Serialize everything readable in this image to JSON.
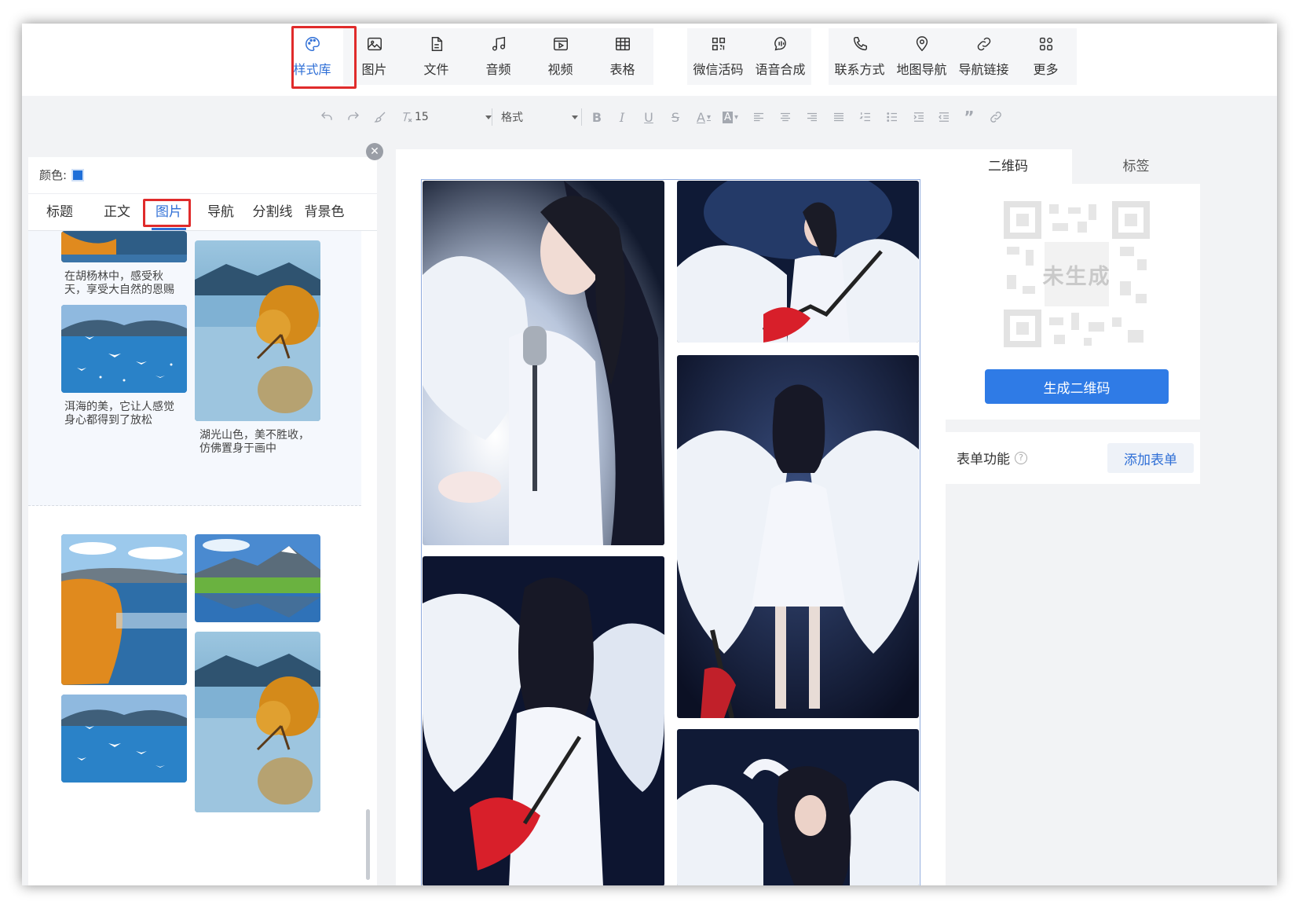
{
  "toolbar": {
    "group1": [
      {
        "label": "样式库",
        "icon": "palette-icon",
        "active": true
      },
      {
        "label": "图片",
        "icon": "image-icon"
      },
      {
        "label": "文件",
        "icon": "file-icon"
      },
      {
        "label": "音频",
        "icon": "music-icon"
      },
      {
        "label": "视频",
        "icon": "video-icon"
      },
      {
        "label": "表格",
        "icon": "table-icon"
      }
    ],
    "group2": [
      {
        "label": "微信活码",
        "icon": "qrcode-icon"
      },
      {
        "label": "语音合成",
        "icon": "voice-icon"
      }
    ],
    "group3": [
      {
        "label": "联系方式",
        "icon": "phone-icon"
      },
      {
        "label": "地图导航",
        "icon": "map-pin-icon"
      },
      {
        "label": "导航链接",
        "icon": "link-icon"
      },
      {
        "label": "更多",
        "icon": "grid-icon"
      }
    ]
  },
  "format_bar": {
    "font_size": "15",
    "format_label": "格式"
  },
  "left_panel": {
    "color_label": "颜色:",
    "color_value": "#1f6fd8",
    "tabs": [
      "标题",
      "正文",
      "图片",
      "导航",
      "分割线",
      "背景色"
    ],
    "active_tab": "图片",
    "captions": {
      "autumn": "在胡杨林中，感受秋天，享受大自然的恩赐",
      "erhai": "洱海的美，它让人感觉身心都得到了放松",
      "lake": "湖光山色，美不胜收，仿佛置身于画中"
    }
  },
  "right_panel": {
    "tabs": [
      "二维码",
      "标签"
    ],
    "qr_status": "未生成",
    "generate_button": "生成二维码",
    "form_label": "表单功能",
    "help_mark": "?",
    "add_form_button": "添加表单"
  }
}
